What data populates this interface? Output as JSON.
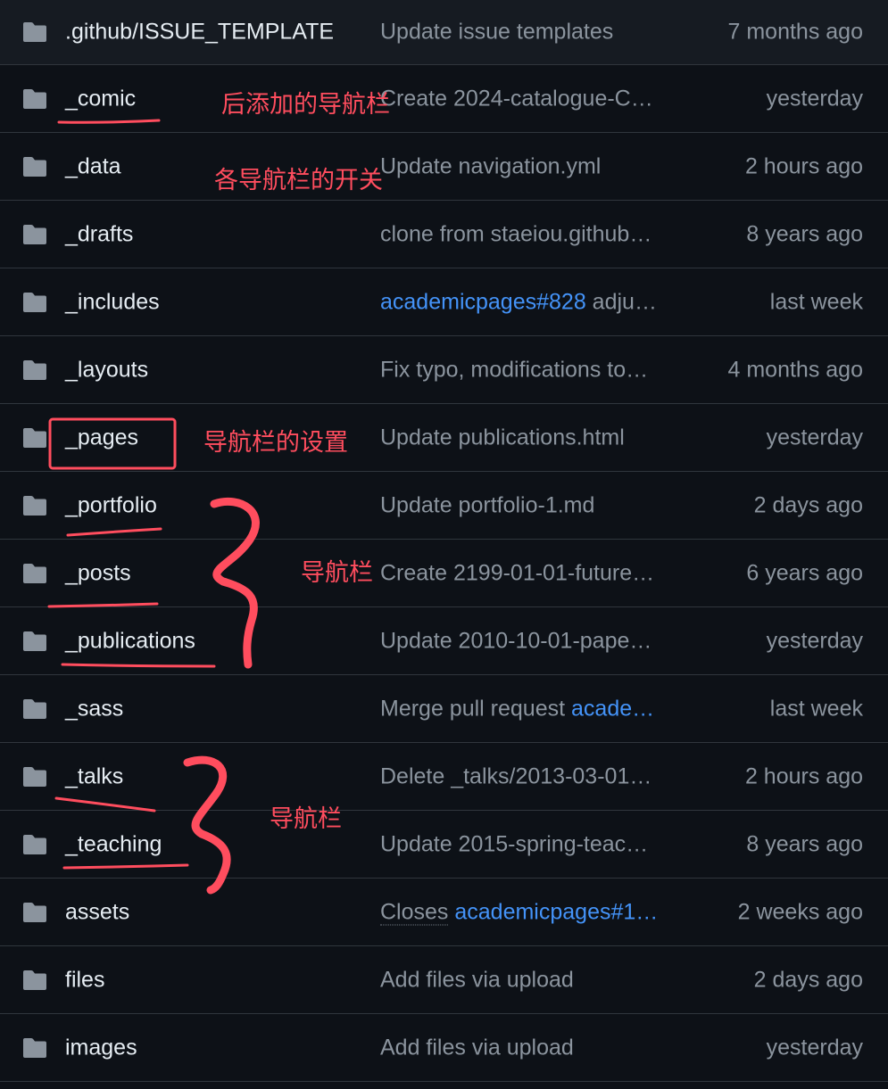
{
  "colors": {
    "background": "#0d1117",
    "header_row": "#161b22",
    "border": "#30363d",
    "text": "#e6edf3",
    "muted": "#8b949e",
    "link": "#4493f8",
    "icon": "#8b949e",
    "annotation": "#ff4d5e"
  },
  "rows": [
    {
      "name": ".github/ISSUE_TEMPLATE",
      "icon": "folder-icon",
      "msg": "Update issue templates",
      "time": "7 months ago"
    },
    {
      "name": "_comic",
      "icon": "folder-icon",
      "msg": "Create 2024-catalogue-C…",
      "time": "yesterday"
    },
    {
      "name": "_data",
      "icon": "folder-icon",
      "msg": "Update navigation.yml",
      "time": "2 hours ago"
    },
    {
      "name": "_drafts",
      "icon": "folder-icon",
      "msg": "clone from staeiou.github…",
      "time": "8 years ago"
    },
    {
      "name": "_includes",
      "icon": "folder-icon",
      "msg_link": "academicpages#828",
      "msg_rest": " adju…",
      "time": "last week"
    },
    {
      "name": "_layouts",
      "icon": "folder-icon",
      "msg": "Fix typo, modifications to…",
      "time": "4 months ago"
    },
    {
      "name": "_pages",
      "icon": "folder-icon",
      "msg": "Update publications.html",
      "time": "yesterday"
    },
    {
      "name": "_portfolio",
      "icon": "folder-icon",
      "msg": "Update portfolio-1.md",
      "time": "2 days ago"
    },
    {
      "name": "_posts",
      "icon": "folder-icon",
      "msg": "Create 2199-01-01-future…",
      "time": "6 years ago"
    },
    {
      "name": "_publications",
      "icon": "folder-icon",
      "msg": "Update 2010-10-01-pape…",
      "time": "yesterday"
    },
    {
      "name": "_sass",
      "icon": "folder-icon",
      "msg_pre": "Merge pull request ",
      "msg_link": "acade…",
      "time": "last week"
    },
    {
      "name": "_talks",
      "icon": "folder-icon",
      "msg": "Delete _talks/2013-03-01…",
      "time": "2 hours ago"
    },
    {
      "name": "_teaching",
      "icon": "folder-icon",
      "msg": "Update 2015-spring-teac…",
      "time": "8 years ago"
    },
    {
      "name": "assets",
      "icon": "folder-icon",
      "msg_pre_dotted": "Closes",
      "msg_link": " academicpages#1…",
      "time": "2 weeks ago"
    },
    {
      "name": "files",
      "icon": "folder-icon",
      "msg": "Add files via upload",
      "time": "2 days ago"
    },
    {
      "name": "images",
      "icon": "folder-icon",
      "msg": "Add files via upload",
      "time": "yesterday"
    }
  ],
  "annotations": {
    "comic_note": "后添加的导航栏",
    "data_note": "各导航栏的开关",
    "pages_note": "导航栏的设置",
    "group1_note": "导航栏",
    "group2_note": "导航栏"
  }
}
